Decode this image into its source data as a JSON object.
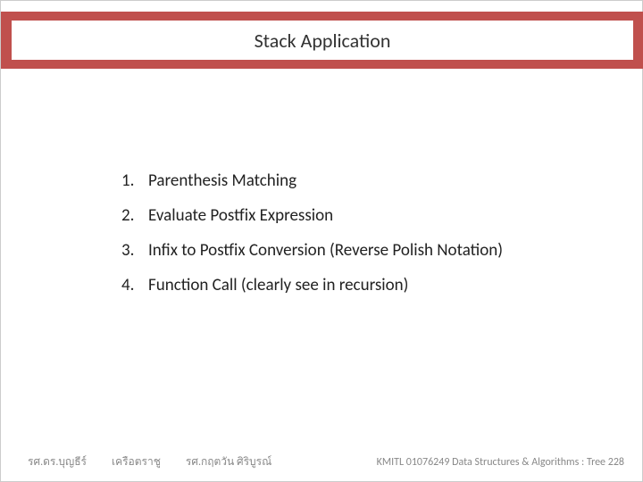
{
  "title": "Stack Application",
  "items": [
    {
      "num": "1.",
      "text": "Parenthesis Matching"
    },
    {
      "num": "2.",
      "text": "Evaluate Postfix Expression"
    },
    {
      "num": "3.",
      "text": "Infix to Postfix Conversion  (Reverse Polish Notation)"
    },
    {
      "num": "4.",
      "text": "Function Call (clearly see in recursion)"
    }
  ],
  "footer": {
    "left1": "รศ.ดร.บุญธีร์",
    "left2": "เครือตราชู",
    "left3": "รศ.กฤตวัน   ศิริบูรณ์",
    "right": "KMITL   01076249 Data Structures & Algorithms : Tree 228"
  }
}
